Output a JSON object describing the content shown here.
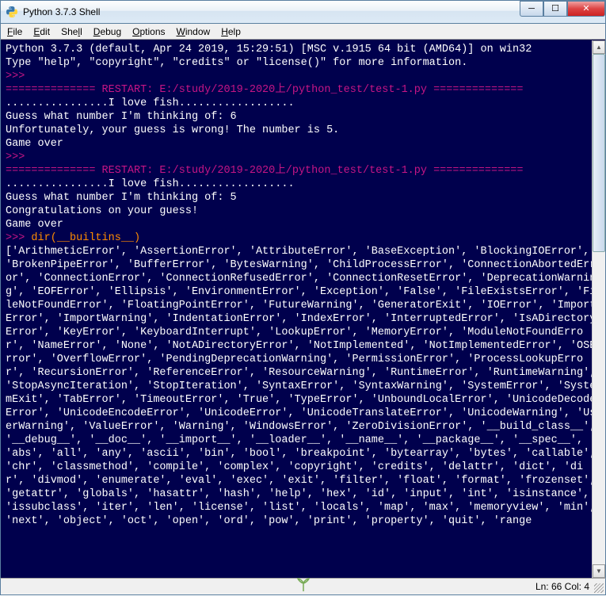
{
  "window": {
    "title": "Python 3.7.3 Shell"
  },
  "menu": {
    "file": "File",
    "edit": "Edit",
    "shell": "Shell",
    "debug": "Debug",
    "options": "Options",
    "window": "Window",
    "help": "Help"
  },
  "status": {
    "text": "Ln: 66  Col: 4"
  },
  "console": {
    "banner1": "Python 3.7.3 (default, Apr 24 2019, 15:29:51) [MSC v.1915 64 bit (AMD64)] on win32",
    "banner2": "Type \"help\", \"copyright\", \"credits\" or \"license()\" for more information.",
    "prompt": ">>>",
    "restart": "============== RESTART: E:/study/2019-2020上/python_test/test-1.py ==============",
    "fishline": "................I love fish..................",
    "run1_guess": "Guess what number I'm thinking of: 6",
    "run1_result": "Unfortunately, your guess is wrong! The number is 5.",
    "gameover": "Game over",
    "run2_guess": "Guess what number I'm thinking of: 5",
    "run2_result": "Congratulations on your guess!",
    "cmd": " dir(__builtins__)",
    "builtins": "['ArithmeticError', 'AssertionError', 'AttributeError', 'BaseException', 'BlockingIOError', 'BrokenPipeError', 'BufferError', 'BytesWarning', 'ChildProcessError', 'ConnectionAbortedError', 'ConnectionError', 'ConnectionRefusedError', 'ConnectionResetError', 'DeprecationWarning', 'EOFError', 'Ellipsis', 'EnvironmentError', 'Exception', 'False', 'FileExistsError', 'FileNotFoundError', 'FloatingPointError', 'FutureWarning', 'GeneratorExit', 'IOError', 'ImportError', 'ImportWarning', 'IndentationError', 'IndexError', 'InterruptedError', 'IsADirectoryError', 'KeyError', 'KeyboardInterrupt', 'LookupError', 'MemoryError', 'ModuleNotFoundError', 'NameError', 'None', 'NotADirectoryError', 'NotImplemented', 'NotImplementedError', 'OSError', 'OverflowError', 'PendingDeprecationWarning', 'PermissionError', 'ProcessLookupError', 'RecursionError', 'ReferenceError', 'ResourceWarning', 'RuntimeError', 'RuntimeWarning', 'StopAsyncIteration', 'StopIteration', 'SyntaxError', 'SyntaxWarning', 'SystemError', 'SystemExit', 'TabError', 'TimeoutError', 'True', 'TypeError', 'UnboundLocalError', 'UnicodeDecodeError', 'UnicodeEncodeError', 'UnicodeError', 'UnicodeTranslateError', 'UnicodeWarning', 'UserWarning', 'ValueError', 'Warning', 'WindowsError', 'ZeroDivisionError', '__build_class__', '__debug__', '__doc__', '__import__', '__loader__', '__name__', '__package__', '__spec__', 'abs', 'all', 'any', 'ascii', 'bin', 'bool', 'breakpoint', 'bytearray', 'bytes', 'callable', 'chr', 'classmethod', 'compile', 'complex', 'copyright', 'credits', 'delattr', 'dict', 'dir', 'divmod', 'enumerate', 'eval', 'exec', 'exit', 'filter', 'float', 'format', 'frozenset', 'getattr', 'globals', 'hasattr', 'hash', 'help', 'hex', 'id', 'input', 'int', 'isinstance', 'issubclass', 'iter', 'len', 'license', 'list', 'locals', 'map', 'max', 'memoryview', 'min', 'next', 'object', 'oct', 'open', 'ord', 'pow', 'print', 'property', 'quit', 'range"
  }
}
